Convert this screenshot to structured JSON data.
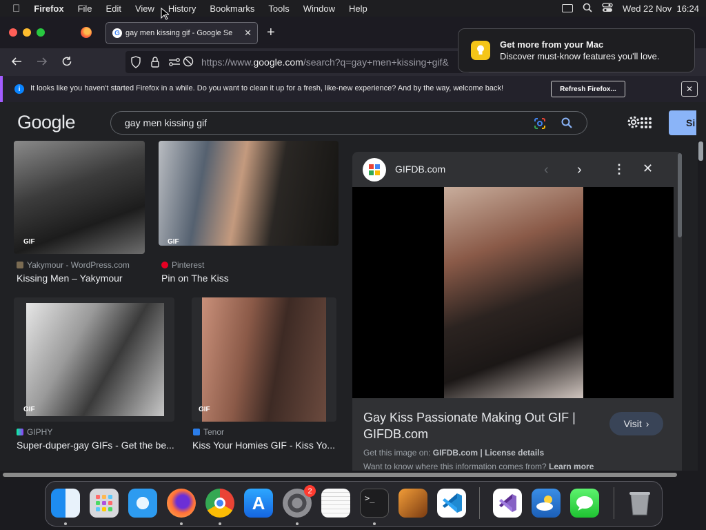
{
  "menubar": {
    "app": "Firefox",
    "items": [
      "File",
      "Edit",
      "View",
      "History",
      "Bookmarks",
      "Tools",
      "Window",
      "Help"
    ],
    "datetime": "Wed 22 Nov  16:24"
  },
  "tab": {
    "title": "gay men kissing gif - Google Se"
  },
  "url": {
    "prefix": "https://www.",
    "domain": "google.com",
    "path": "/search?q=gay+men+kissing+gif&"
  },
  "notification": {
    "title": "Get more from your Mac",
    "body": "Discover must-know features you'll love."
  },
  "infobar": {
    "message": "It looks like you haven't started Firefox in a while. Do you want to clean it up for a fresh, like-new experience? And by the way, welcome back!",
    "button": "Refresh Firefox..."
  },
  "google": {
    "logo": "Google",
    "query": "gay men kissing gif",
    "signin": "Si"
  },
  "results": [
    {
      "source": "Yakymour - WordPress.com",
      "title": "Kissing Men – Yakymour",
      "badge": "GIF"
    },
    {
      "source": "Pinterest",
      "title": "Pin on The Kiss",
      "badge": "GIF"
    },
    {
      "source": "GIPHY",
      "title": "Super-duper-gay GIFs - Get the be...",
      "badge": "GIF"
    },
    {
      "source": "Tenor",
      "title": "Kiss Your Homies GIF - Kiss Yo...",
      "badge": "GIF"
    }
  ],
  "preview": {
    "site": "GIFDB.com",
    "title_line1": "Gay Kiss Passionate Making Out GIF |",
    "title_line2": "GIFDB.com",
    "get_image_prefix": "Get this image on:",
    "get_image_site": "GIFDB.com",
    "separator": "|",
    "license": "License details",
    "want_to_know": "Want to know where this information comes from?",
    "learn_more": "Learn more",
    "visit": "Visit"
  },
  "dock": {
    "badge_count": "2"
  }
}
